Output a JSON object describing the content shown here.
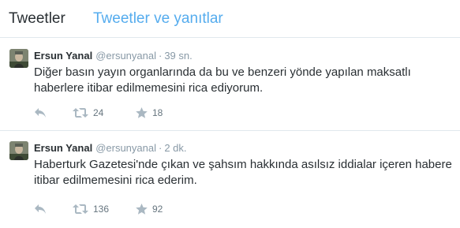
{
  "tabs": {
    "tweets": "Tweetler",
    "tweets_replies": "Tweetler ve yanıtlar"
  },
  "tweets": [
    {
      "fullname": "Ersun Yanal",
      "username": "@ersunyanal",
      "separator": "·",
      "time": "39 sn.",
      "text": "Diğer basın yayın organlarında da bu ve benzeri yönde yapılan maksatlı haberlere itibar edilmemesini rica ediyorum.",
      "retweets": "24",
      "favorites": "18"
    },
    {
      "fullname": "Ersun Yanal",
      "username": "@ersunyanal",
      "separator": "·",
      "time": "2 dk.",
      "text": "Haberturk Gazetesi'nde çıkan ve şahsım hakkında asılsız iddialar içeren habere itibar edilmemesini rica ederim.",
      "retweets": "136",
      "favorites": "92"
    }
  ],
  "icons": {
    "reply": "reply-icon",
    "retweet": "retweet-icon",
    "favorite": "star-icon"
  },
  "colors": {
    "accent": "#55acee",
    "text": "#292f33",
    "muted": "#8899a6",
    "icon": "#aab8c2",
    "border": "#e1e8ed"
  }
}
